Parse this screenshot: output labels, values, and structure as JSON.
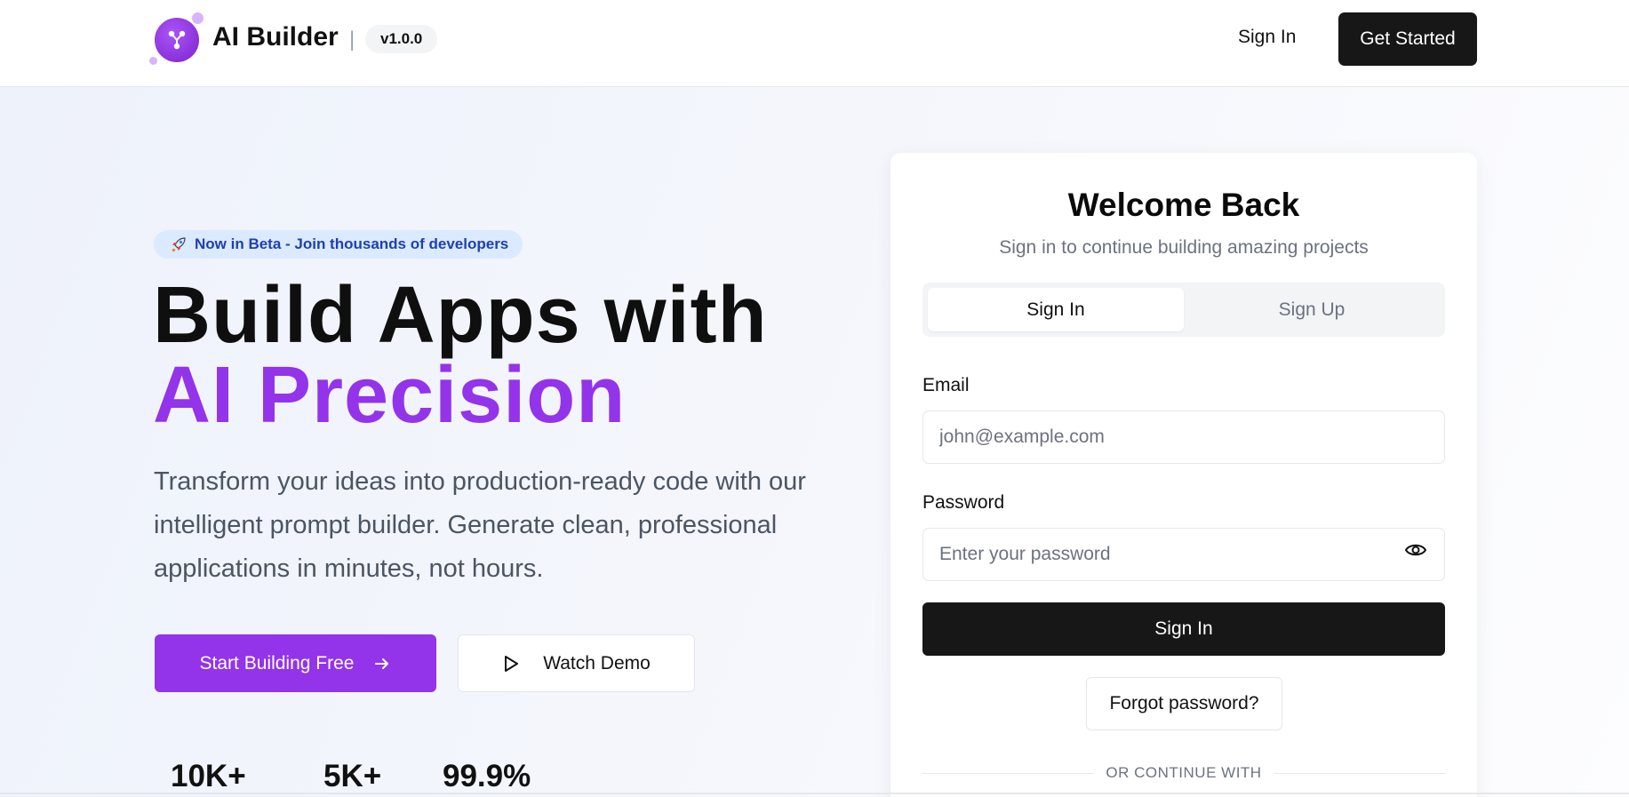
{
  "colors": {
    "accent": "#9333ea",
    "dark_button": "#171717",
    "beta_badge_bg": "#dbeafe",
    "beta_badge_text": "#1e40af"
  },
  "navbar": {
    "brand": "AI Builder",
    "separator": "|",
    "version": "v1.0.0",
    "sign_in": "Sign In",
    "get_started": "Get Started",
    "logo_icon": "ai-network-icon"
  },
  "hero": {
    "badge_icon": "rocket-icon",
    "badge_text": "Now in Beta - Join thousands of developers",
    "headline_line1": "Build Apps with",
    "headline_line2": "AI Precision",
    "subtext": "Transform your ideas into production-ready code with our intelligent prompt builder. Generate clean, professional applications in minutes, not hours.",
    "primary_button": "Start Building Free",
    "secondary_button": "Watch Demo",
    "stats": [
      "10K+",
      "5K+",
      "99.9%"
    ]
  },
  "auth_card": {
    "title": "Welcome Back",
    "subtitle": "Sign in to continue building amazing projects",
    "tabs": [
      {
        "label": "Sign In",
        "active": true
      },
      {
        "label": "Sign Up",
        "active": false
      }
    ],
    "email_label": "Email",
    "email_placeholder": "john@example.com",
    "password_label": "Password",
    "password_placeholder": "Enter your password",
    "submit": "Sign In",
    "forgot": "Forgot password?",
    "divider": "OR CONTINUE WITH"
  }
}
